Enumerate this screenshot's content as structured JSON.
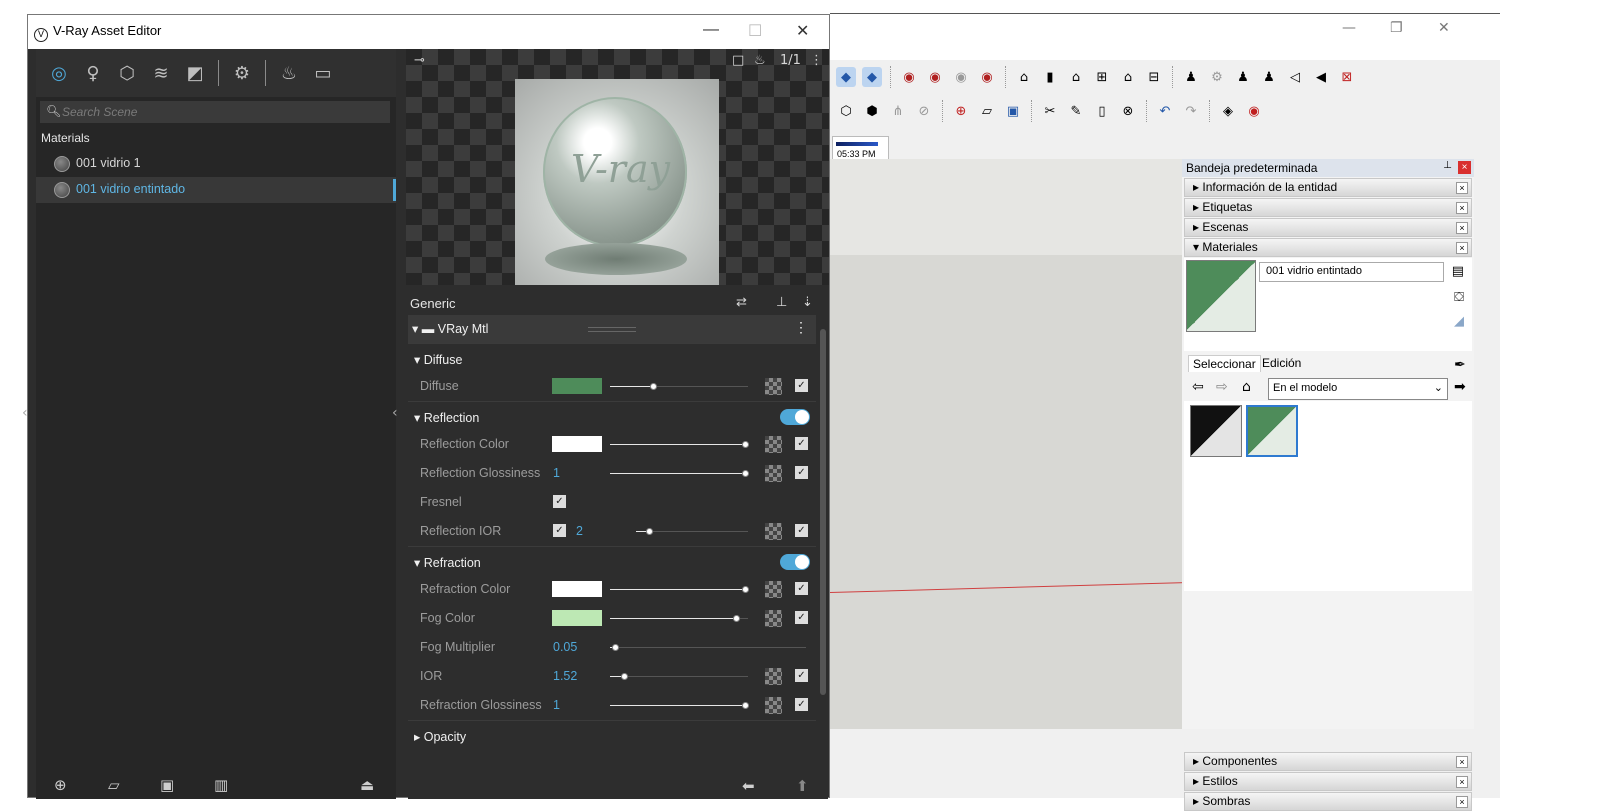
{
  "sketchup": {
    "window_controls": [
      "—",
      "❐",
      "✕"
    ],
    "time_label": "05:33 PM",
    "tray": {
      "title": "Bandeja predeterminada",
      "panels_top": [
        "Información de la entidad",
        "Etiquetas",
        "Escenas",
        "Materiales"
      ],
      "material_name": "001 vidrio entintado",
      "tabs": [
        "Seleccionar",
        "Edición"
      ],
      "dropdown_value": "En el modelo",
      "panels_bottom": [
        "Componentes",
        "Estilos",
        "Sombras"
      ],
      "swatch_color": "#4e8c5a"
    }
  },
  "vray": {
    "title": "V-Ray Asset Editor",
    "window_controls": [
      "—",
      "☐",
      "✕"
    ],
    "search_placeholder": "Search Scene",
    "materials_header": "Materials",
    "materials": [
      "001 vidrio 1",
      "001 vidrio entintado"
    ],
    "preview_counter": "1/1",
    "preview_text": "V-ray",
    "generic_label": "Generic",
    "vraymtl_label": "VRay Mtl",
    "sections": {
      "diffuse": {
        "title": "Diffuse",
        "rows": [
          {
            "label": "Diffuse",
            "color": "#4e8c5a",
            "slider": 0.3
          }
        ]
      },
      "reflection": {
        "title": "Reflection",
        "enabled": true,
        "rows": [
          {
            "label": "Reflection Color",
            "color": "#ffffff",
            "slider": 1.0
          },
          {
            "label": "Reflection Glossiness",
            "value": "1",
            "slider": 1.0
          },
          {
            "label": "Fresnel",
            "checked": true
          },
          {
            "label": "Reflection IOR",
            "value": "2",
            "slider": 0.1
          }
        ]
      },
      "refraction": {
        "title": "Refraction",
        "enabled": true,
        "rows": [
          {
            "label": "Refraction Color",
            "color": "#ffffff",
            "slider": 1.0
          },
          {
            "label": "Fog Color",
            "color": "#bde8b4",
            "slider": 0.93
          },
          {
            "label": "Fog Multiplier",
            "value": "0.05",
            "slider": 0.02
          },
          {
            "label": "IOR",
            "value": "1.52",
            "slider": 0.1
          },
          {
            "label": "Refraction Glossiness",
            "value": "1",
            "slider": 1.0
          }
        ]
      },
      "opacity": {
        "title": "Opacity"
      }
    },
    "accent": "#4fa8d8"
  }
}
